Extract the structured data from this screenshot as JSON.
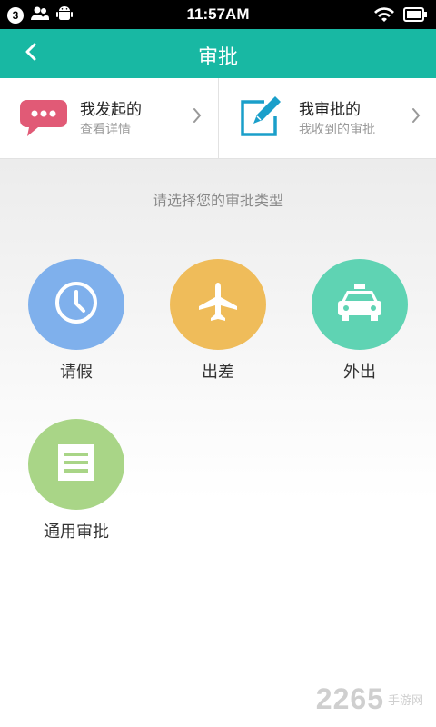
{
  "status": {
    "badge": "3",
    "time": "11:57AM"
  },
  "header": {
    "title": "审批"
  },
  "cards": [
    {
      "title": "我发起的",
      "subtitle": "查看详情"
    },
    {
      "title": "我审批的",
      "subtitle": "我收到的审批"
    }
  ],
  "prompt": "请选择您的审批类型",
  "types": [
    {
      "label": "请假",
      "color": "#7fb0ec"
    },
    {
      "label": "出差",
      "color": "#efbc5a"
    },
    {
      "label": "外出",
      "color": "#5fd3b3"
    },
    {
      "label": "通用审批",
      "color": "#a9d587"
    }
  ],
  "watermark": {
    "number": "2265",
    "text": "手游网"
  },
  "colors": {
    "accent": "#18b8a3",
    "chat_icon": "#e15a76",
    "edit_icon": "#1a9fca"
  }
}
